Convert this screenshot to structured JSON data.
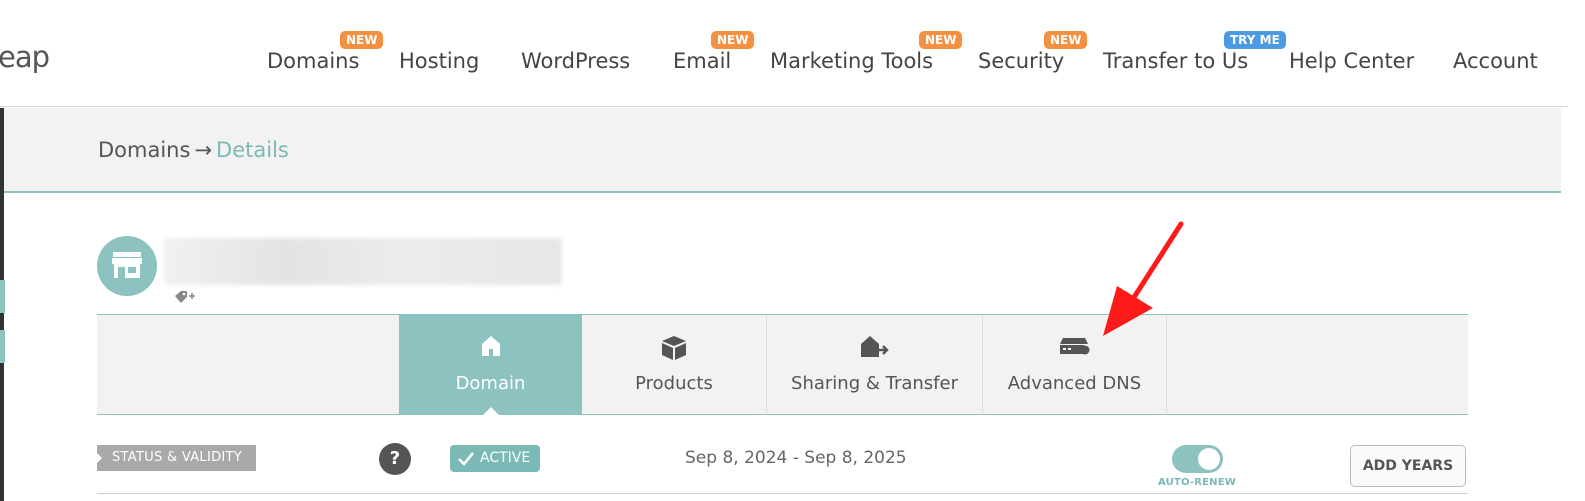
{
  "header": {
    "logo_text": "eap",
    "nav": [
      {
        "label": "Domains",
        "badge": "NEW",
        "badge_type": "new"
      },
      {
        "label": "Hosting",
        "badge": "",
        "badge_type": ""
      },
      {
        "label": "WordPress",
        "badge": "",
        "badge_type": ""
      },
      {
        "label": "Email",
        "badge": "NEW",
        "badge_type": "new"
      },
      {
        "label": "Marketing Tools",
        "badge": "NEW",
        "badge_type": "new"
      },
      {
        "label": "Security",
        "badge": "NEW",
        "badge_type": "new"
      },
      {
        "label": "Transfer to Us",
        "badge": "TRY ME",
        "badge_type": "try"
      },
      {
        "label": "Help Center",
        "badge": "",
        "badge_type": ""
      },
      {
        "label": "Account",
        "badge": "",
        "badge_type": ""
      }
    ]
  },
  "breadcrumb": {
    "parent": "Domains",
    "separator": "→",
    "current": "Details"
  },
  "domain": {
    "icon": "storefront-icon",
    "name_redacted": true
  },
  "tabs": [
    {
      "label": "Domain",
      "icon": "home-icon",
      "active": true
    },
    {
      "label": "Products",
      "icon": "box-icon",
      "active": false
    },
    {
      "label": "Sharing & Transfer",
      "icon": "house-transfer-icon",
      "active": false
    },
    {
      "label": "Advanced DNS",
      "icon": "server-icon",
      "active": false
    }
  ],
  "status": {
    "label": "STATUS & VALIDITY",
    "help": "?",
    "state": "ACTIVE",
    "dates": "Sep 8, 2024 - Sep 8, 2025",
    "auto_renew_label": "AUTO-RENEW",
    "auto_renew_on": true,
    "add_years_label": "ADD YEARS"
  },
  "colors": {
    "accent": "#8cc2c0",
    "badge_new": "#f39141",
    "badge_try": "#4b9be3",
    "annotation": "#ff0000"
  }
}
